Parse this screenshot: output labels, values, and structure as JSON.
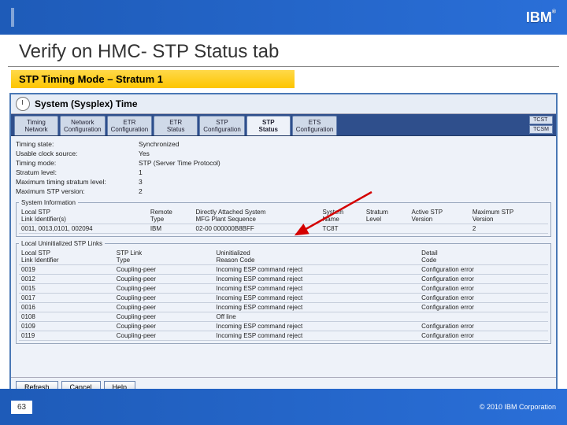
{
  "slide": {
    "title": "Verify on HMC- STP Status tab",
    "callout": "STP Timing Mode – Stratum 1",
    "page_num": "63",
    "copyright": "© 2010 IBM Corporation",
    "ibm": "IBM",
    "reg": "®"
  },
  "panel": {
    "title": "System (Sysplex) Time"
  },
  "tabs": {
    "t0": "Timing\nNetwork",
    "t1": "Network\nConfiguration",
    "t2": "ETR\nConfiguration",
    "t3": "ETR\nStatus",
    "t4": "STP\nConfiguration",
    "t5": "STP\nStatus",
    "t6": "ETS\nConfiguration",
    "b0": "TCST",
    "b1": "TCSM"
  },
  "status": {
    "l0": "Timing state:",
    "v0": "Synchronized",
    "l1": "Usable clock source:",
    "v1": "Yes",
    "l2": "Timing mode:",
    "v2": "STP (Server Time Protocol)",
    "l3": "Stratum level:",
    "v3": "1",
    "l4": "Maximum timing stratum level:",
    "v4": "3",
    "l5": "Maximum STP version:",
    "v5": "2"
  },
  "sysinfo": {
    "legend": "System Information",
    "h0": "Local STP\nLink Identifier(s)",
    "h1": "Remote\nType",
    "h2": "Directly Attached System\nMFG Plant Sequence",
    "h3": "System\nName",
    "h4": "Stratum\nLevel",
    "h5": "Active STP\nVersion",
    "h6": "Maximum STP\nVersion",
    "r0_0": "0011, 0013,0101, 002094",
    "r0_1": "IBM",
    "r0_2": "02-00 000000B8BFF",
    "r0_3": "TC8T",
    "r0_4": "",
    "r0_5": "",
    "r0_6": "2"
  },
  "links": {
    "legend": "Local Uninitialized STP Links",
    "h0": "Local STP\nLink Identifier",
    "h1": "STP Link\nType",
    "h2": "Uninitialized\nReason Code",
    "h3": "Detail\nCode",
    "rows": [
      {
        "c0": "0019",
        "c1": "Coupling-peer",
        "c2": "Incoming ESP command reject",
        "c3": "Configuration error"
      },
      {
        "c0": "0012",
        "c1": "Coupling-peer",
        "c2": "Incoming ESP command reject",
        "c3": "Configuration error"
      },
      {
        "c0": "0015",
        "c1": "Coupling-peer",
        "c2": "Incoming ESP command reject",
        "c3": "Configuration error"
      },
      {
        "c0": "0017",
        "c1": "Coupling-peer",
        "c2": "Incoming ESP command reject",
        "c3": "Configuration error"
      },
      {
        "c0": "0016",
        "c1": "Coupling-peer",
        "c2": "Incoming ESP command reject",
        "c3": "Configuration error"
      },
      {
        "c0": "0108",
        "c1": "Coupling-peer",
        "c2": "Off line",
        "c3": ""
      },
      {
        "c0": "0109",
        "c1": "Coupling-peer",
        "c2": "Incoming ESP command reject",
        "c3": "Configuration error"
      },
      {
        "c0": "0119",
        "c1": "Coupling-peer",
        "c2": "Incoming ESP command reject",
        "c3": "Configuration error"
      }
    ]
  },
  "buttons": {
    "refresh": "Refresh",
    "cancel": "Cancel",
    "help": "Help"
  }
}
